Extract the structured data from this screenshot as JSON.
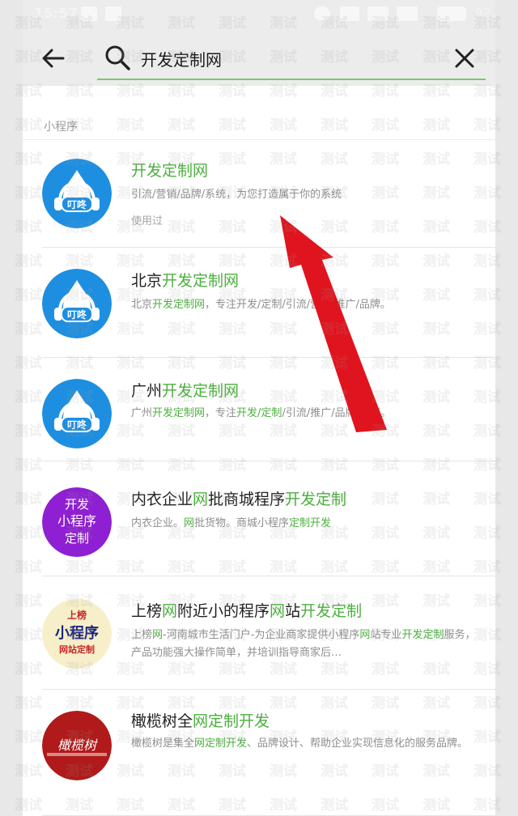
{
  "status": {
    "time": "15:57",
    "battery": "92"
  },
  "search": {
    "query": "开发定制网"
  },
  "section": {
    "label": "小程序"
  },
  "items": [
    {
      "title": [
        {
          "t": "开发定制网",
          "h": true
        }
      ],
      "desc": [
        {
          "t": "引流/营销/品牌/系统，为您打造属于你的系统",
          "h": false
        }
      ],
      "used": "使用过",
      "avatar_text": "叮咚"
    },
    {
      "title": [
        {
          "t": "北京",
          "h": false
        },
        {
          "t": "开发定制网",
          "h": true
        }
      ],
      "desc": [
        {
          "t": "北京",
          "h": false
        },
        {
          "t": "开发定制网",
          "h": true
        },
        {
          "t": "，专注开发/定制/引流/营销/推广/品牌。",
          "h": false
        }
      ],
      "avatar_text": "叮咚"
    },
    {
      "title": [
        {
          "t": "广州",
          "h": false
        },
        {
          "t": "开发定制网",
          "h": true
        }
      ],
      "desc": [
        {
          "t": "广州",
          "h": false
        },
        {
          "t": "开发定制网",
          "h": true
        },
        {
          "t": "，专注",
          "h": false
        },
        {
          "t": "开发/定制",
          "h": true
        },
        {
          "t": "/引流/推广/品牌/营销。",
          "h": false
        }
      ],
      "avatar_text": "叮咚"
    },
    {
      "title": [
        {
          "t": "内衣企业",
          "h": false
        },
        {
          "t": "网",
          "h": true
        },
        {
          "t": "批商城程序",
          "h": false
        },
        {
          "t": "开发定制",
          "h": true
        }
      ],
      "desc": [
        {
          "t": "内衣企业。",
          "h": false
        },
        {
          "t": "网",
          "h": true
        },
        {
          "t": "批货物。商城小程序",
          "h": false
        },
        {
          "t": "定制开发",
          "h": true
        }
      ],
      "avatar_lines": [
        "开发",
        "小程序",
        "定制"
      ]
    },
    {
      "title": [
        {
          "t": "上榜",
          "h": false
        },
        {
          "t": "网",
          "h": true
        },
        {
          "t": "附近小的程序",
          "h": false
        },
        {
          "t": "网",
          "h": true
        },
        {
          "t": "站",
          "h": false
        },
        {
          "t": "开发定制",
          "h": true
        }
      ],
      "desc": [
        {
          "t": "上榜",
          "h": false
        },
        {
          "t": "网",
          "h": true
        },
        {
          "t": "-河南城市生活门户-为企业商家提供小程序",
          "h": false
        },
        {
          "t": "网",
          "h": true
        },
        {
          "t": "站专业",
          "h": false
        },
        {
          "t": "开发定制",
          "h": true
        },
        {
          "t": "服务，产品功能强大操作简单，并培训指导商家后…",
          "h": false
        }
      ],
      "avatar_lines": [
        "上榜",
        "小程序",
        "网站定制"
      ]
    },
    {
      "title": [
        {
          "t": "橄榄树全",
          "h": false
        },
        {
          "t": "网定制开发",
          "h": true
        }
      ],
      "desc": [
        {
          "t": "橄榄树是集全",
          "h": false
        },
        {
          "t": "网定制开发",
          "h": true
        },
        {
          "t": "、品牌设计、帮助企业实现信息化的服务品牌。",
          "h": false
        }
      ],
      "avatar_text": "橄榄树"
    }
  ],
  "watermark": {
    "text": "测试"
  },
  "colors": {
    "highlight": "#4caf3f",
    "arrow": "#e0141e",
    "accent_blue": "#1e8fe0",
    "purple": "#8f1fd2",
    "red_logo": "#b01a1a"
  }
}
